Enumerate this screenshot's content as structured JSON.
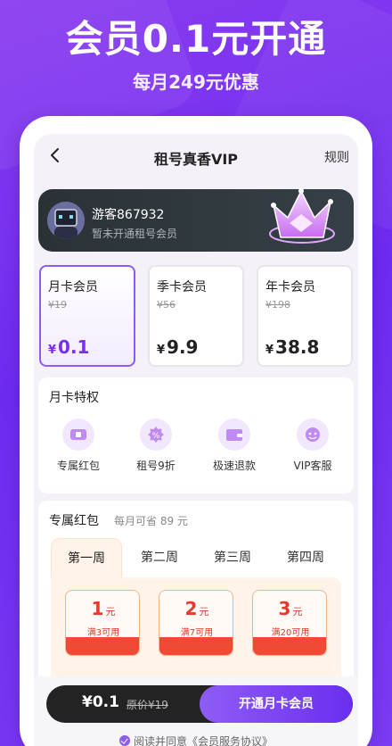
{
  "hero": {
    "title": "会员0.1元开通",
    "subtitle": "每月249元优惠"
  },
  "topbar": {
    "title": "租号真香VIP",
    "rules": "规则"
  },
  "user": {
    "name": "游客867932",
    "status": "暂未开通租号会员"
  },
  "plans": [
    {
      "name": "月卡会员",
      "original": "¥19",
      "price": "0.1",
      "selected": true
    },
    {
      "name": "季卡会员",
      "original": "¥56",
      "price": "9.9",
      "selected": false
    },
    {
      "name": "年卡会员",
      "original": "¥198",
      "price": "38.8",
      "selected": false
    }
  ],
  "currency": "¥",
  "benefits": {
    "title": "月卡特权",
    "items": [
      {
        "label": "专属红包",
        "icon": "coupon-icon"
      },
      {
        "label": "租号9折",
        "icon": "discount-icon"
      },
      {
        "label": "极速退款",
        "icon": "wallet-icon"
      },
      {
        "label": "VIP客服",
        "icon": "support-icon"
      }
    ]
  },
  "coupons": {
    "title": "专属红包",
    "subtitle": "每月可省 89 元",
    "weeks": [
      "第一周",
      "第二周",
      "第三周",
      "第四周"
    ],
    "active_week": 0,
    "unit": "元",
    "items": [
      {
        "amount": "1",
        "condition": "满3可用"
      },
      {
        "amount": "2",
        "condition": "满7可用"
      },
      {
        "amount": "3",
        "condition": "满20可用"
      }
    ]
  },
  "bottom": {
    "price": "¥0.1",
    "original": "原价¥19",
    "cta": "开通月卡会员",
    "agree": "阅读并同意《会员服务协议》"
  },
  "colors": {
    "accent": "#7a2fe8",
    "coupon_red": "#e53a2a"
  }
}
